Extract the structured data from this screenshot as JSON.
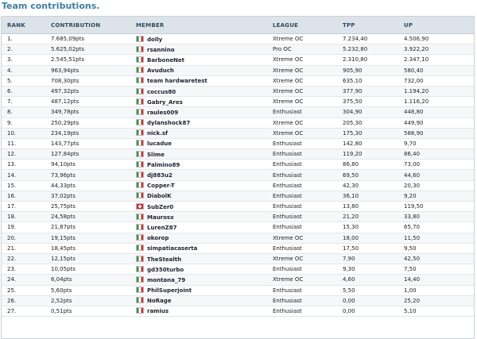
{
  "title": "Team contributions.",
  "columns": [
    "RANK",
    "CONTRIBUTION",
    "MEMBER",
    "LEAGUE",
    "TPP",
    "UP"
  ],
  "colors": {
    "title": "#3a7fa8",
    "header_bg": "#dce4ea"
  },
  "rows": [
    {
      "rank": "1.",
      "contribution": "7.685,09pts",
      "flag": "it",
      "member": "dolly",
      "league": "Xtreme OC",
      "tpp": "7.234,40",
      "up": "4.506,90"
    },
    {
      "rank": "2.",
      "contribution": "5.625,02pts",
      "flag": "it",
      "member": "rsannino",
      "league": "Pro OC",
      "tpp": "5.232,80",
      "up": "3.922,20"
    },
    {
      "rank": "3.",
      "contribution": "2.545,51pts",
      "flag": "it",
      "member": "BarboneNet",
      "league": "Xtreme OC",
      "tpp": "2.310,80",
      "up": "2.347,10"
    },
    {
      "rank": "4.",
      "contribution": "963,94pts",
      "flag": "it",
      "member": "Avuduch",
      "league": "Xtreme OC",
      "tpp": "905,90",
      "up": "580,40"
    },
    {
      "rank": "5.",
      "contribution": "708,30pts",
      "flag": "it",
      "member": "team hardwaretest",
      "league": "Xtreme OC",
      "tpp": "635,10",
      "up": "732,00"
    },
    {
      "rank": "6.",
      "contribution": "497,32pts",
      "flag": "it",
      "member": "coccus80",
      "league": "Xtreme OC",
      "tpp": "377,90",
      "up": "1.194,20"
    },
    {
      "rank": "7.",
      "contribution": "487,12pts",
      "flag": "it",
      "member": "Gabry_Ares",
      "league": "Xtreme OC",
      "tpp": "375,50",
      "up": "1.116,20"
    },
    {
      "rank": "8.",
      "contribution": "349,78pts",
      "flag": "it",
      "member": "raules009",
      "league": "Enthusiast",
      "tpp": "304,90",
      "up": "448,80"
    },
    {
      "rank": "9.",
      "contribution": "250,29pts",
      "flag": "it",
      "member": "dylanshock87",
      "league": "Xtreme OC",
      "tpp": "205,30",
      "up": "449,90"
    },
    {
      "rank": "10.",
      "contribution": "234,19pts",
      "flag": "it",
      "member": "nick.sf",
      "league": "Xtreme OC",
      "tpp": "175,30",
      "up": "588,90"
    },
    {
      "rank": "11.",
      "contribution": "143,77pts",
      "flag": "it",
      "member": "lucadue",
      "league": "Enthusiast",
      "tpp": "142,80",
      "up": "9,70"
    },
    {
      "rank": "12.",
      "contribution": "127,84pts",
      "flag": "it",
      "member": "Slime",
      "league": "Enthusiast",
      "tpp": "119,20",
      "up": "86,40"
    },
    {
      "rank": "13.",
      "contribution": "94,10pts",
      "flag": "it",
      "member": "Palmino89",
      "league": "Enthusiast",
      "tpp": "86,80",
      "up": "73,00"
    },
    {
      "rank": "14.",
      "contribution": "73,96pts",
      "flag": "it",
      "member": "dj883u2",
      "league": "Enthusiast",
      "tpp": "69,50",
      "up": "44,60"
    },
    {
      "rank": "15.",
      "contribution": "44,33pts",
      "flag": "it",
      "member": "Copper-T",
      "league": "Enthusiast",
      "tpp": "42,30",
      "up": "20,30"
    },
    {
      "rank": "16.",
      "contribution": "37,02pts",
      "flag": "it",
      "member": "DiabolK",
      "league": "Enthusiast",
      "tpp": "36,10",
      "up": "9,20"
    },
    {
      "rank": "17.",
      "contribution": "25,75pts",
      "flag": "ch",
      "member": "SubZer0",
      "league": "Enthusiast",
      "tpp": "13,80",
      "up": "119,50"
    },
    {
      "rank": "18.",
      "contribution": "24,58pts",
      "flag": "it",
      "member": "Maurosx",
      "league": "Enthusiast",
      "tpp": "21,20",
      "up": "33,80"
    },
    {
      "rank": "19.",
      "contribution": "21,87pts",
      "flag": "it",
      "member": "LurenZ87",
      "league": "Enthusiast",
      "tpp": "15,30",
      "up": "65,70"
    },
    {
      "rank": "20.",
      "contribution": "19,15pts",
      "flag": "it",
      "member": "okorop",
      "league": "Xtreme OC",
      "tpp": "18,00",
      "up": "11,50"
    },
    {
      "rank": "21.",
      "contribution": "18,45pts",
      "flag": "it",
      "member": "simpatiacaserta",
      "league": "Enthusiast",
      "tpp": "17,50",
      "up": "9,50"
    },
    {
      "rank": "22.",
      "contribution": "12,15pts",
      "flag": "it",
      "member": "TheStealth",
      "league": "Xtreme OC",
      "tpp": "7,90",
      "up": "42,50"
    },
    {
      "rank": "23.",
      "contribution": "10,05pts",
      "flag": "it",
      "member": "gd350turbo",
      "league": "Enthusiast",
      "tpp": "9,30",
      "up": "7,50"
    },
    {
      "rank": "24.",
      "contribution": "6,04pts",
      "flag": "it",
      "member": "montana_79",
      "league": "Xtreme OC",
      "tpp": "4,60",
      "up": "14,40"
    },
    {
      "rank": "25.",
      "contribution": "5,60pts",
      "flag": "it",
      "member": "PhilSuperjoint",
      "league": "Enthusiast",
      "tpp": "5,50",
      "up": "1,00"
    },
    {
      "rank": "26.",
      "contribution": "2,52pts",
      "flag": "it",
      "member": "NoRage",
      "league": "Enthusiast",
      "tpp": "0,00",
      "up": "25,20"
    },
    {
      "rank": "27.",
      "contribution": "0,51pts",
      "flag": "it",
      "member": "ramius",
      "league": "Enthusiast",
      "tpp": "0,00",
      "up": "5,10"
    }
  ]
}
